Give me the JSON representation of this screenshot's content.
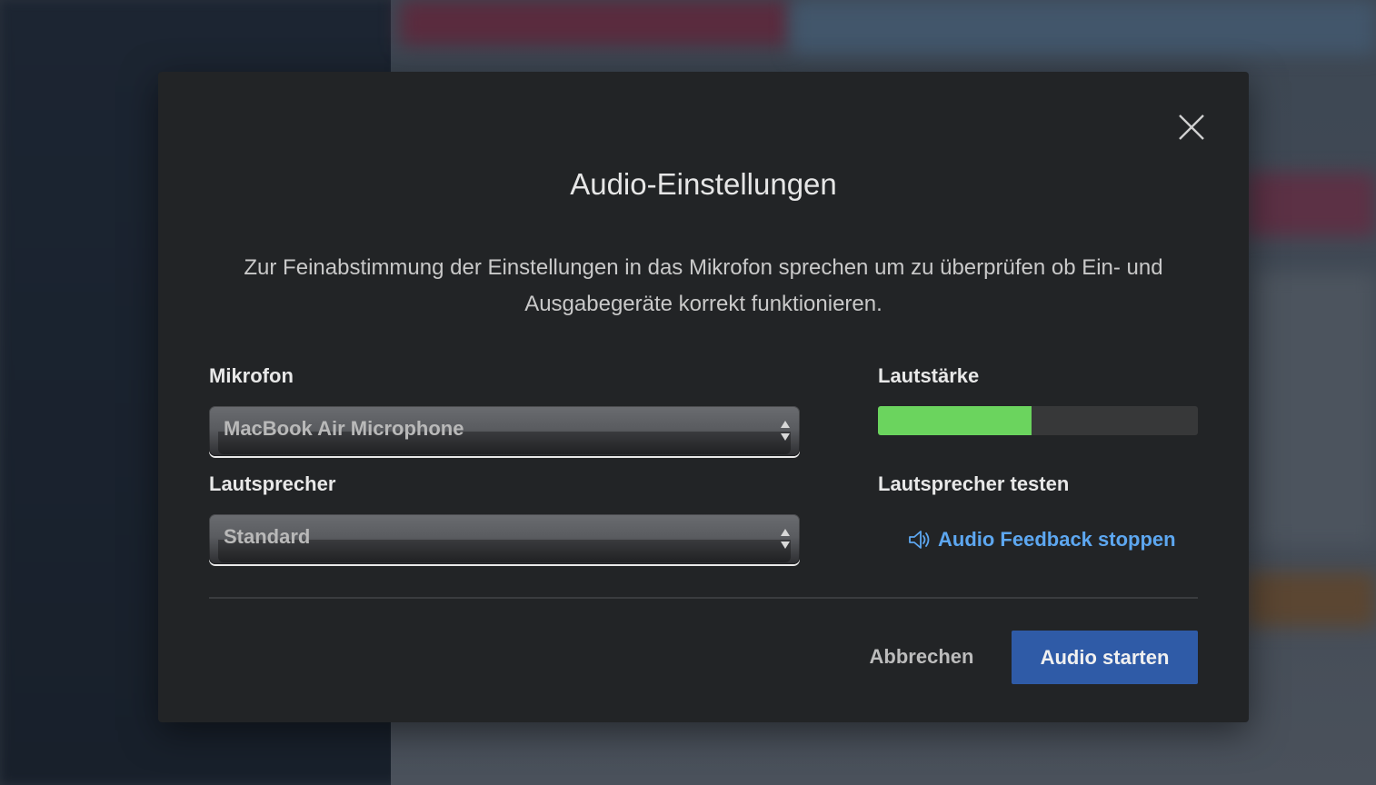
{
  "dialog": {
    "title": "Audio-Einstellungen",
    "description": "Zur Feinabstimmung der Einstellungen in das Mikrofon sprechen um zu überprüfen ob Ein- und Ausgabegeräte korrekt funktionieren.",
    "close_icon": "close-icon"
  },
  "microphone": {
    "label": "Mikrofon",
    "selected": "MacBook Air Microphone"
  },
  "speaker": {
    "label": "Lautsprecher",
    "selected": "Standard"
  },
  "volume": {
    "label": "Lautstärke",
    "level": 0.48,
    "fill_color": "#6bd45e"
  },
  "speaker_test": {
    "label": "Lautsprecher testen",
    "link_text": "Audio Feedback stoppen",
    "icon": "speaker-icon",
    "link_color": "#5da7f0"
  },
  "footer": {
    "cancel_label": "Abbrechen",
    "start_label": "Audio starten",
    "start_color": "#2f5ba7"
  }
}
